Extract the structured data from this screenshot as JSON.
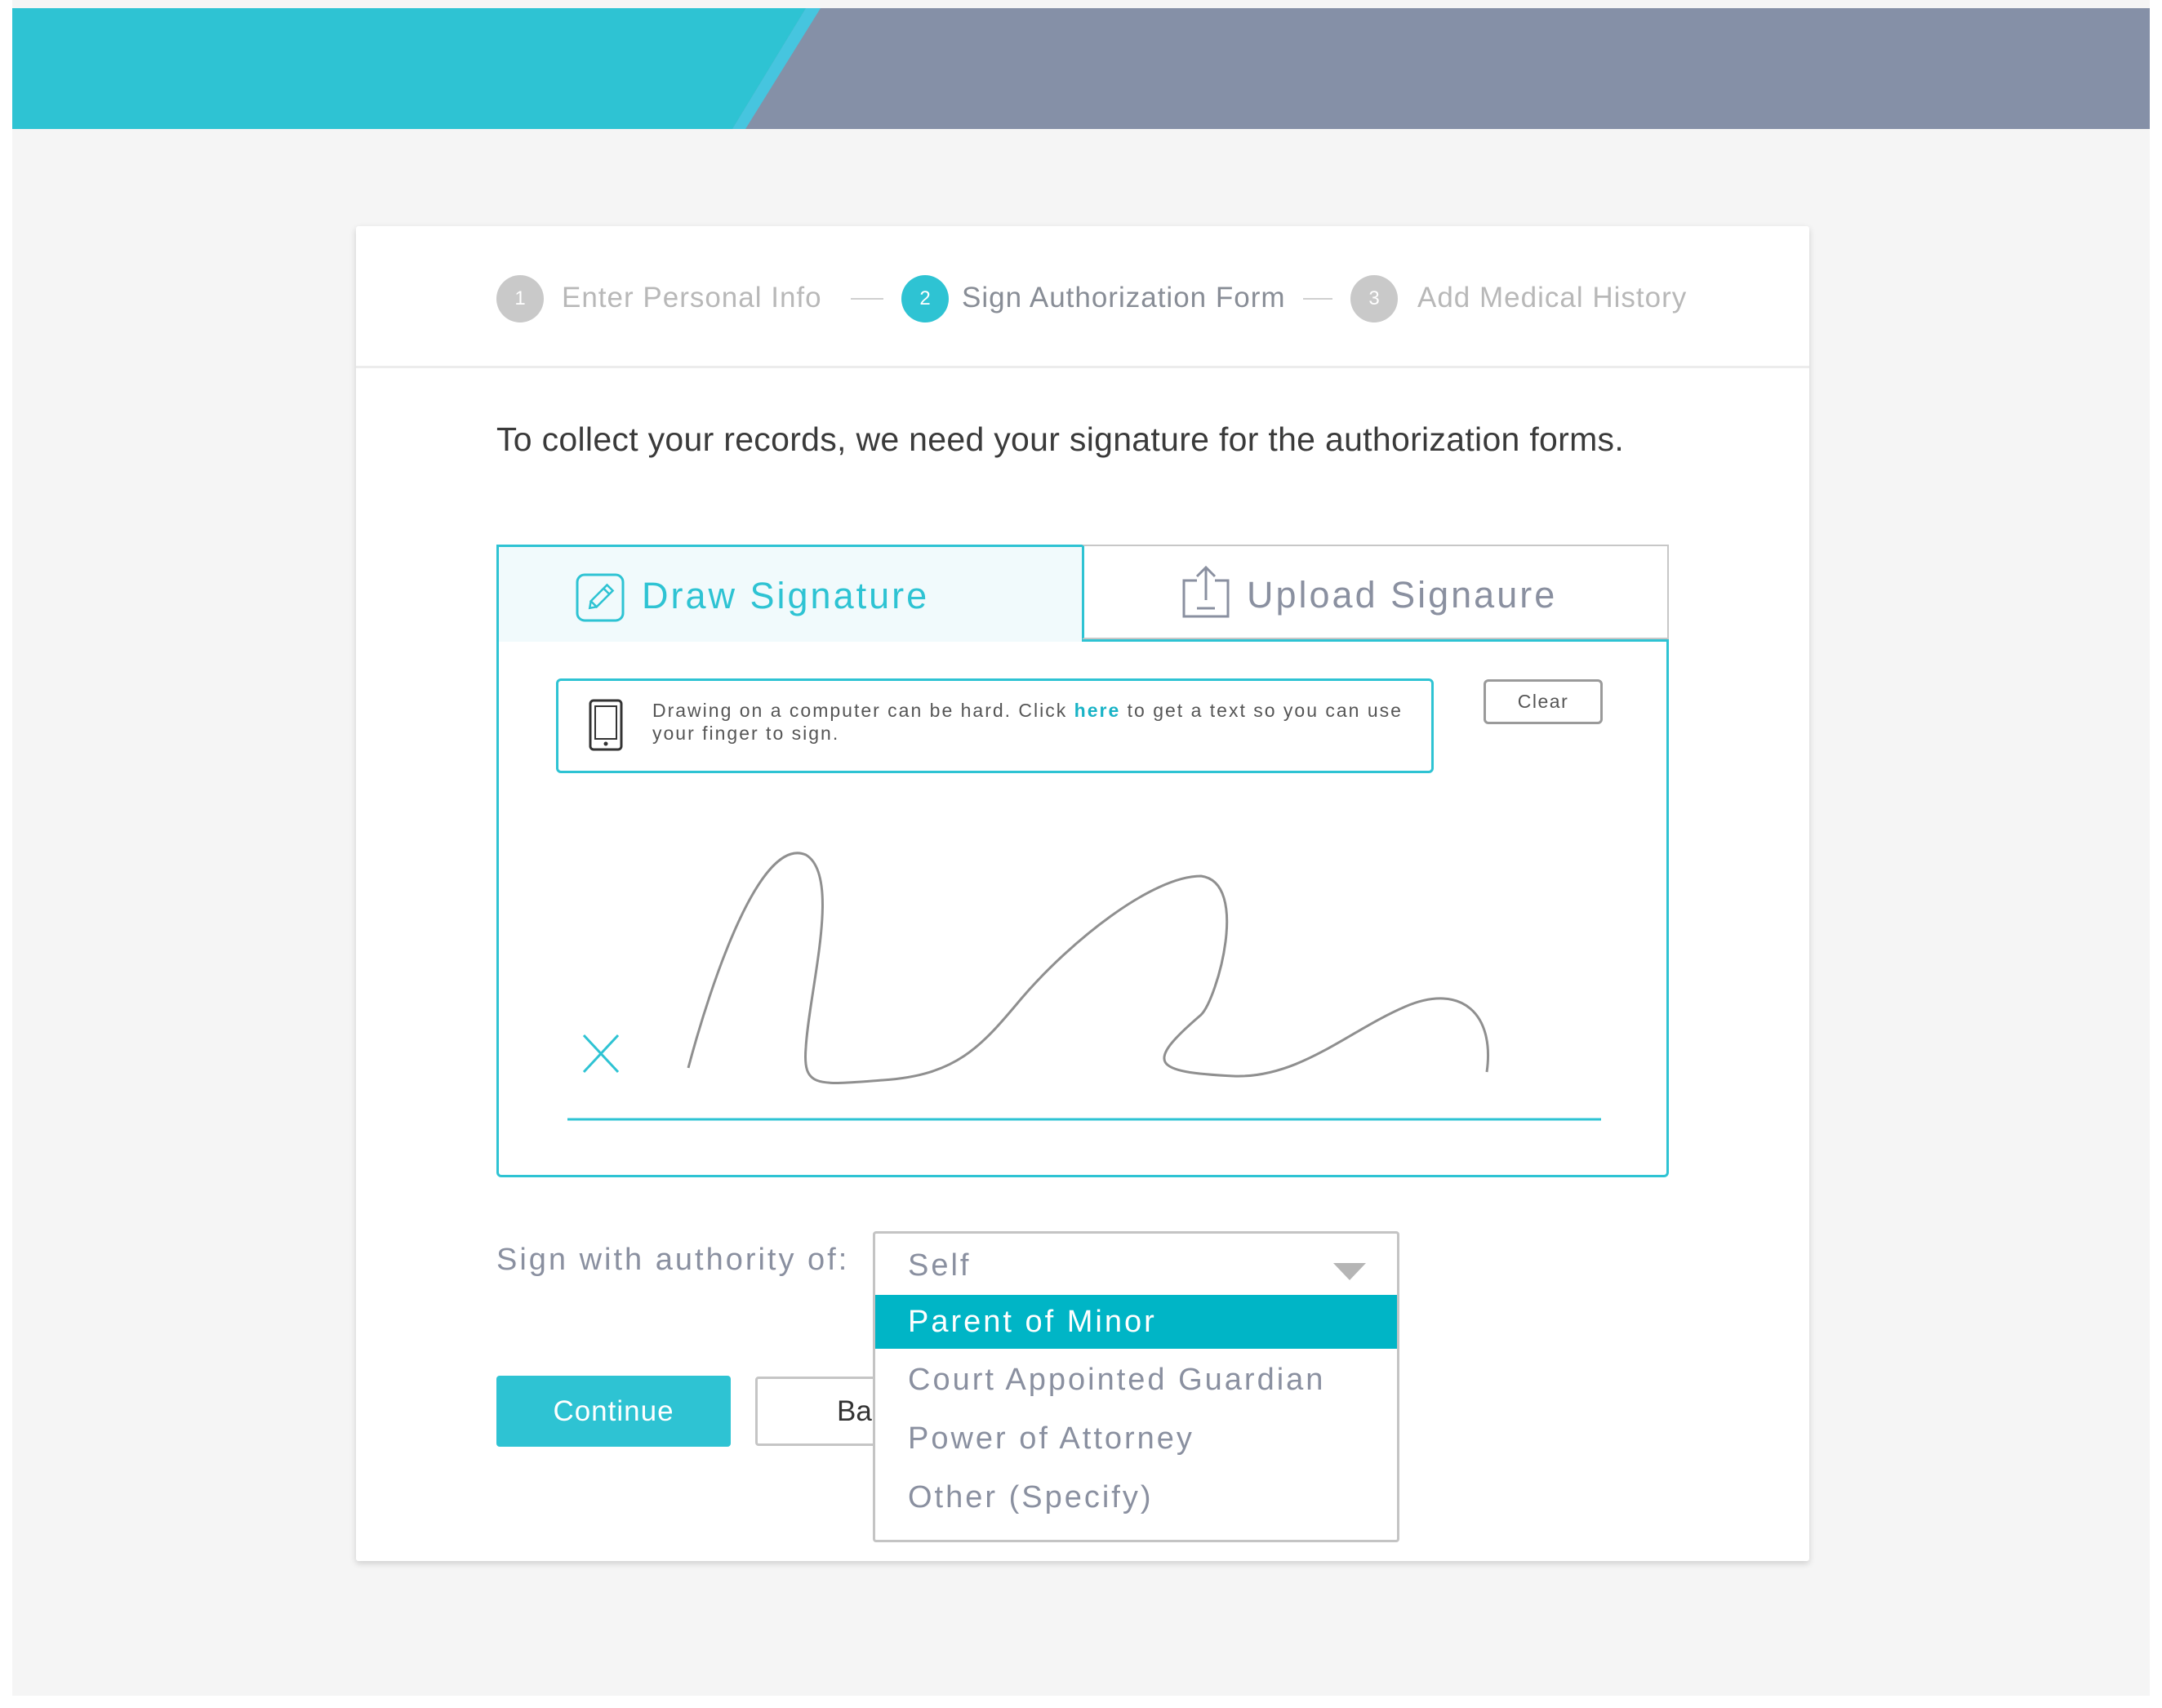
{
  "steps": [
    {
      "number": "1",
      "label": "Enter Personal Info",
      "state": "done"
    },
    {
      "number": "2",
      "label": "Sign Authorization Form",
      "state": "active"
    },
    {
      "number": "3",
      "label": "Add Medical History",
      "state": "pending"
    }
  ],
  "intro": "To collect your records, we need your signature for the authorization forms.",
  "signature": {
    "tabs": {
      "draw": {
        "label": "Draw Signature",
        "icon": "pencil-square-icon"
      },
      "upload": {
        "label": "Upload Signaure",
        "icon": "upload-icon"
      }
    },
    "tip": {
      "text_before": "Drawing on a computer can be hard. Click ",
      "link": "here",
      "text_after": " to get  a text so  you can use your finger to sign.",
      "icon": "phone-icon"
    },
    "clear_label": "Clear",
    "sign_mark": "x-icon"
  },
  "authority": {
    "label": "Sign with authority of:",
    "selected": "Self",
    "options": [
      "Parent of Minor",
      "Court Appointed Guardian",
      "Power of Attorney",
      "Other (Specify)"
    ],
    "highlighted": "Parent of Minor"
  },
  "buttons": {
    "continue": "Continue",
    "back": "Back"
  },
  "colors": {
    "accent": "#2ec3d3",
    "header_dark": "#8590a7",
    "highlight": "#00b5c6"
  }
}
